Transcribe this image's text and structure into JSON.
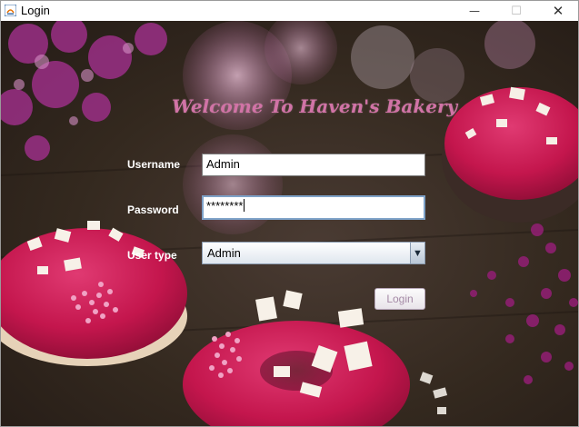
{
  "window": {
    "title": "Login",
    "controls": {
      "minimize": "—",
      "maximize": "☐",
      "close": "✕"
    }
  },
  "form": {
    "heading": "Welcome To Haven's Bakery",
    "username": {
      "label": "Username",
      "value": "Admin"
    },
    "password": {
      "label": "Password",
      "value": "********"
    },
    "user_type": {
      "label": "User type",
      "selected": "Admin",
      "arrow": "▼"
    },
    "login_button": "Login"
  },
  "colors": {
    "heading": "#d173a6",
    "background": "#34291f",
    "donut_glaze": "#c4164d",
    "flowers": "#9b2f86"
  }
}
